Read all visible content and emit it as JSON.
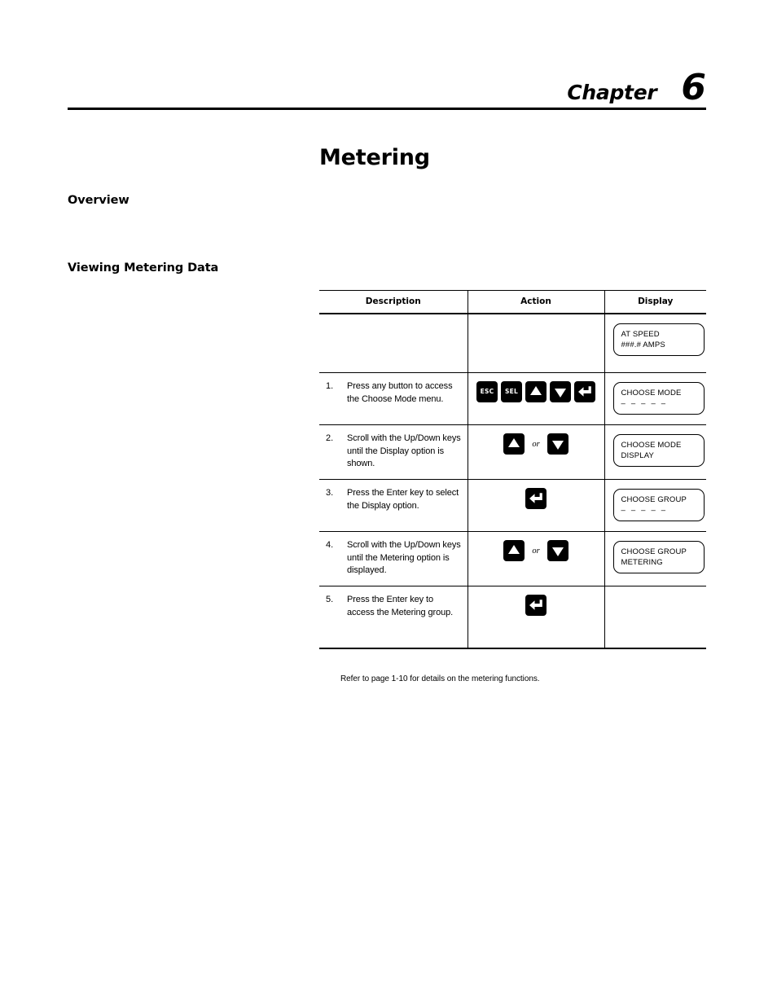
{
  "header": {
    "chapter_label": "Chapter",
    "chapter_number": "6"
  },
  "page_title": "Metering",
  "sections": {
    "overview": {
      "heading": "Overview",
      "body": ""
    },
    "viewing": {
      "heading": "Viewing Metering Data"
    }
  },
  "table": {
    "columns": {
      "description": "Description",
      "action": "Action",
      "display": "Display"
    },
    "rows": [
      {
        "step": "",
        "description": "",
        "keys": [],
        "display": {
          "line1": "AT SPEED",
          "line2": "###.# AMPS",
          "line2_dashes": false
        }
      },
      {
        "step": "1.",
        "description": "Press any button to access the Choose Mode menu.",
        "keys": [
          "esc-key",
          "sel-key",
          "up-arrow-key",
          "down-arrow-key",
          "enter-key"
        ],
        "display": {
          "line1": "CHOOSE MODE",
          "line2": "– – – – –",
          "line2_dashes": true
        }
      },
      {
        "step": "2.",
        "description": "Scroll with the Up/Down keys until the Display option is shown.",
        "keys": [
          "up-arrow-key",
          "or",
          "down-arrow-key"
        ],
        "display": {
          "line1": "CHOOSE MODE",
          "line2": "DISPLAY",
          "line2_dashes": false
        }
      },
      {
        "step": "3.",
        "description": "Press the Enter key to select the Display option.",
        "keys": [
          "enter-key"
        ],
        "display": {
          "line1": "CHOOSE GROUP",
          "line2": "– – – – –",
          "line2_dashes": true
        }
      },
      {
        "step": "4.",
        "description": "Scroll with the Up/Down keys until the Metering option is displayed.",
        "keys": [
          "up-arrow-key",
          "or",
          "down-arrow-key"
        ],
        "display": {
          "line1": "CHOOSE GROUP",
          "line2": "METERING",
          "line2_dashes": false
        }
      },
      {
        "step": "5.",
        "description": "Press the Enter key to access the Metering group.",
        "keys": [
          "enter-key"
        ],
        "display": null
      }
    ],
    "key_labels": {
      "esc": "ESC",
      "sel": "SEL",
      "or": "or"
    },
    "footnote": "Refer to page 1-10 for details on the metering functions."
  },
  "colors": {
    "ink": "#000000",
    "page": "#ffffff",
    "key_fill": "#000000",
    "key_glyph": "#ffffff"
  }
}
